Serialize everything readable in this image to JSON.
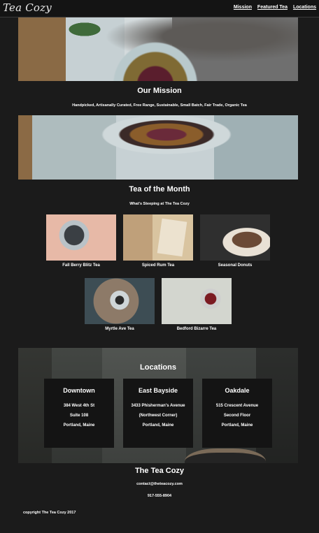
{
  "header": {
    "logo": "Tea Cozy",
    "nav": [
      "Mission",
      "Featured Tea",
      "Locations"
    ]
  },
  "mission": {
    "title": "Our Mission",
    "tags": "Handpicked, Artisanally Curated, Free Range, Sustainable, Small Batch, Fair Trade, Organic Tea"
  },
  "tea_of_month": {
    "title": "Tea of the Month",
    "subtitle": "What's Steeping at The Tea Cozy",
    "teas": [
      {
        "name": "Fall Berry Blitz Tea"
      },
      {
        "name": "Spiced Rum Tea"
      },
      {
        "name": "Seasonal Donuts"
      },
      {
        "name": "Myrtle Ave Tea"
      },
      {
        "name": "Bedford Bizarre Tea"
      }
    ]
  },
  "locations": {
    "title": "Locations",
    "cards": [
      {
        "name": "Downtown",
        "lines": [
          "384 West 4th St",
          "Suite 108",
          "Portland, Maine"
        ]
      },
      {
        "name": "East Bayside",
        "lines": [
          "3433 Phisherman's Avenue",
          "(Northwest Corner)",
          "Portland, Maine"
        ]
      },
      {
        "name": "Oakdale",
        "lines": [
          "515 Crescent Avenue",
          "Second Floor",
          "Portland, Maine"
        ]
      }
    ]
  },
  "footer": {
    "title": "The Tea Cozy",
    "email": "contact@theteacozy.com",
    "phone": "917-555-8904",
    "copyright": "copyright The Tea Cozy 2017"
  }
}
